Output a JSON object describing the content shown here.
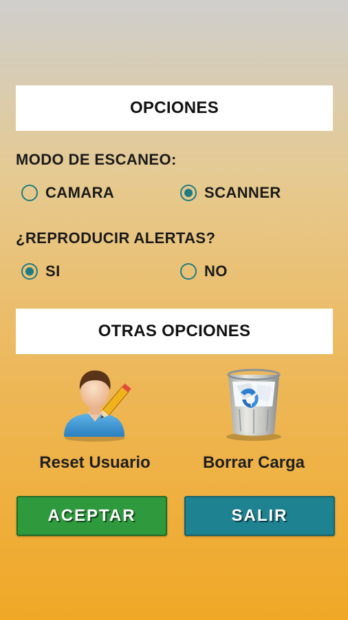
{
  "options_header": "OPCIONES",
  "scan_mode": {
    "label": "MODO DE ESCANEO:",
    "options": [
      "CAMARA",
      "SCANNER"
    ],
    "selected": "SCANNER"
  },
  "alerts": {
    "label": "¿REPRODUCIR ALERTAS?",
    "options": [
      "SI",
      "NO"
    ],
    "selected": "SI"
  },
  "other_header": "OTRAS OPCIONES",
  "tools": {
    "reset_user": {
      "label": "Reset Usuario",
      "icon": "user-edit-icon"
    },
    "clear_load": {
      "label": "Borrar Carga",
      "icon": "recycle-bin-icon"
    }
  },
  "buttons": {
    "accept": "ACEPTAR",
    "exit": "SALIR"
  },
  "colors": {
    "radio": "#1e7b82",
    "accept": "#2e9a3d",
    "exit": "#1e8291"
  }
}
